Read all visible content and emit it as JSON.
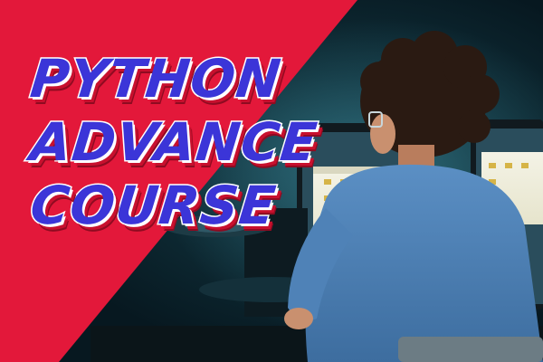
{
  "headline": {
    "line1": "PYTHON",
    "line2": "ADVANCE",
    "line3": "COURSE"
  },
  "colors": {
    "accent_red": "#e3183a",
    "title_fill": "#3b35d8",
    "title_outline": "#ffffff",
    "background_teal": "#0f2e38"
  }
}
